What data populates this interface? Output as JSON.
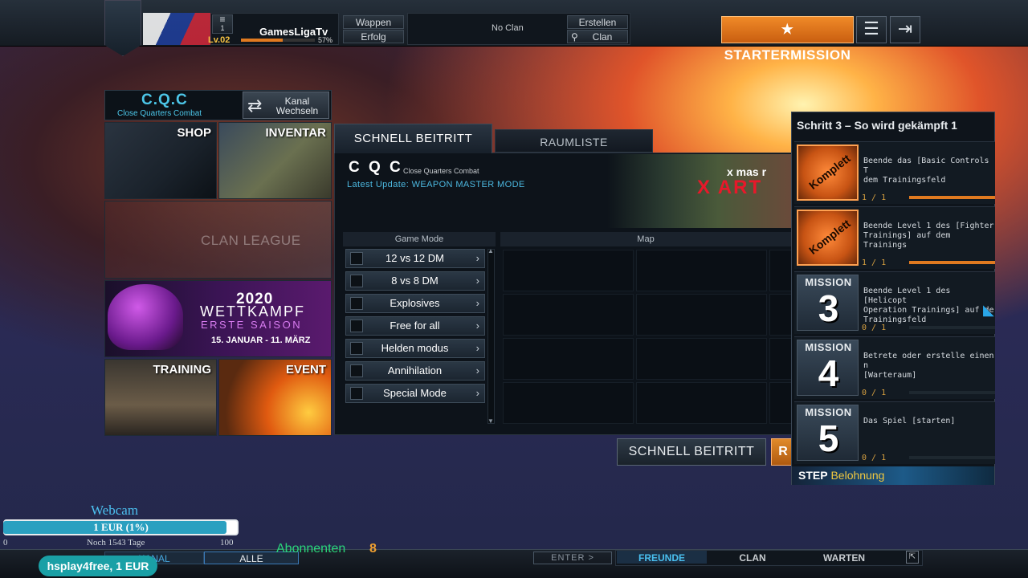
{
  "topbar": {
    "rank_num": "1",
    "level": "Lv.02",
    "player_name": "GamesLigaTv",
    "xp_percent_text": "57%",
    "xp_fraction": 0.57,
    "wappen": "Wappen",
    "erfolg": "Erfolg",
    "no_clan": "No Clan",
    "erstellen": "Erstellen",
    "clan": "Clan",
    "startermission": "STARTERMISSION",
    "menu_icon": "list-icon",
    "exit_icon": "exit-icon"
  },
  "left_menu": {
    "cqc_title": "C.Q.C",
    "cqc_sub": "Close Quarters Combat",
    "kanal_line1": "Kanal",
    "kanal_line2": "Wechseln",
    "shop": "SHOP",
    "inventar": "INVENTAR",
    "clan_league": "CLAN LEAGUE",
    "wk_year": "2020",
    "wk_title": "WETTKAMPF",
    "wk_season": "ERSTE SAISON",
    "wk_date": "15. JANUAR - 11. MÄRZ",
    "training": "TRAINING",
    "event": "EVENT"
  },
  "center": {
    "tab_schnell": "SCHNELL BEITRITT",
    "tab_raumliste": "RAUMLISTE",
    "title": "C Q C",
    "title_sub": "Close Quarters Combat",
    "latest_update": "Latest Update: WEAPON MASTER MODE",
    "banner_line1": "x mas r",
    "banner_line2": "X ART",
    "col_gamemode": "Game Mode",
    "col_map": "Map",
    "modes": [
      {
        "label": "12 vs 12 DM"
      },
      {
        "label": "8 vs 8 DM"
      },
      {
        "label": "Explosives"
      },
      {
        "label": "Free for all"
      },
      {
        "label": "Helden modus"
      },
      {
        "label": "Annihilation"
      },
      {
        "label": "Special Mode"
      }
    ],
    "btn_schnell": "SCHNELL BEITRITT",
    "btn_r": "R"
  },
  "missions": {
    "title": "Schritt 3 – So wird gekämpft 1",
    "komplett": "Komplett",
    "mission_word": "MISSION",
    "rows": [
      {
        "desc": "Beende das [Basic Controls T\ndem Trainingsfeld",
        "progress": "1 / 1",
        "fraction": 1,
        "done": true
      },
      {
        "desc": "Beende Level 1 des [Fighter\nTrainings] auf dem Trainings",
        "progress": "1 / 1",
        "fraction": 1,
        "done": true
      },
      {
        "num": "3",
        "desc": "Beende Level 1 des [Helicopt\nOperation Trainings] auf de\nTrainingsfeld",
        "progress": "0 / 1",
        "fraction": 0,
        "done": false
      },
      {
        "num": "4",
        "desc": "Betrete oder erstelle einen n\n[Warteraum]",
        "progress": "0 / 1",
        "fraction": 0,
        "done": false
      },
      {
        "num": "5",
        "desc": "Das Spiel [starten]",
        "progress": "0 / 1",
        "fraction": 0,
        "done": false
      }
    ],
    "step": "STEP",
    "belohnung": "Belohnung"
  },
  "bottom": {
    "kanal": "KANAL",
    "alle": "ALLE",
    "enter": "ENTER >",
    "freunde": "FREUNDE",
    "clan": "CLAN",
    "warten": "WARTEN"
  },
  "overlay": {
    "webcam": "Webcam",
    "donate_text": "1 EUR (1%)",
    "donate_fraction": 0.01,
    "min": "0",
    "days": "Noch 1543 Tage",
    "max": "100",
    "abonnenten": "Abonnenten",
    "abo_count": "8",
    "donor": "hsplay4free, 1 EUR"
  }
}
